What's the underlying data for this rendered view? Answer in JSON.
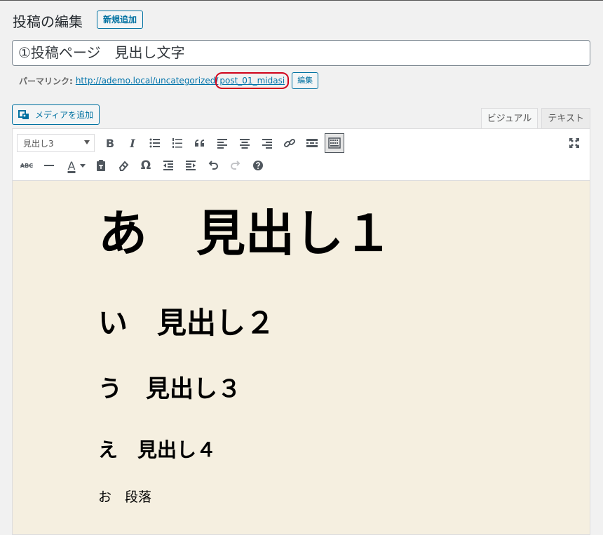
{
  "header": {
    "title": "投稿の編集",
    "add_new_label": "新規追加"
  },
  "post": {
    "title_value": "①投稿ページ　見出し文字"
  },
  "permalink": {
    "label": "パーマリンク:",
    "url": "http://ademo.local/uncategorized/",
    "slug": "post_01_midasi",
    "edit_label": "編集",
    "highlight_color": "#d0021b"
  },
  "media": {
    "add_media_label": "メディアを追加"
  },
  "tabs": [
    {
      "label": "ビジュアル",
      "active": true
    },
    {
      "label": "テキスト",
      "active": false
    }
  ],
  "toolbar": {
    "format_select_value": "見出し3",
    "row1": [
      "bold-icon",
      "italic-icon",
      "bullet-list-icon",
      "numbered-list-icon",
      "blockquote-icon",
      "align-left-icon",
      "align-center-icon",
      "align-right-icon",
      "link-icon",
      "read-more-icon",
      "toolbar-toggle-icon"
    ],
    "row2": [
      "strikethrough-icon",
      "horizontal-line-icon",
      "text-color-icon",
      "paste-as-text-icon",
      "clear-formatting-icon",
      "special-character-icon",
      "outdent-icon",
      "indent-icon",
      "undo-icon",
      "redo-icon",
      "help-icon"
    ],
    "bold_glyph": "B",
    "italic_glyph": "I",
    "text_color_glyph": "A",
    "special_char_glyph": "Ω",
    "abc_glyph": "ABC"
  },
  "content": {
    "h1": "あ　見出し１",
    "h2": "い　見出し２",
    "h3": "う　見出し３",
    "h4": "え　見出し４",
    "paragraph": "お　段落"
  },
  "colors": {
    "accent": "#0071a1",
    "editor_background": "#f5efe0"
  }
}
